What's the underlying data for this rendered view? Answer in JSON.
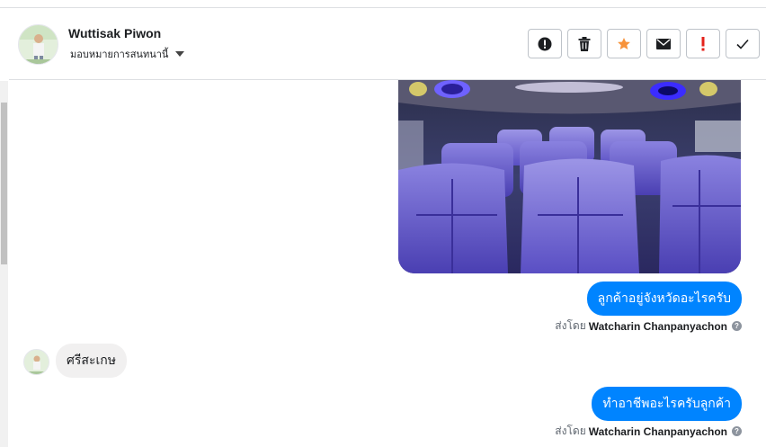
{
  "header": {
    "contact_name": "Wuttisak Piwon",
    "assign_label": "มอบหมายการสนทนานี้"
  },
  "actions": [
    {
      "name": "mark-spam-button",
      "icon": "exclamation-circle-icon"
    },
    {
      "name": "delete-button",
      "icon": "trash-icon"
    },
    {
      "name": "star-button",
      "icon": "star-icon",
      "color": "#f7923a"
    },
    {
      "name": "mark-unread-button",
      "icon": "envelope-icon"
    },
    {
      "name": "follow-up-button",
      "icon": "exclamation-mark-icon",
      "color": "#e4221b"
    },
    {
      "name": "mark-done-button",
      "icon": "checkmark-icon"
    }
  ],
  "messages": [
    {
      "direction": "out",
      "type": "image",
      "subject": "van interior with purple seats"
    },
    {
      "direction": "out",
      "type": "text",
      "text": "ลูกค้าอยู่จังหวัดอะไรครับ",
      "sent_by_prefix": "ส่งโดย",
      "sent_by_name": "Watcharin Chanpanyachon"
    },
    {
      "direction": "in",
      "type": "text",
      "text": "ศรีสะเกษ"
    },
    {
      "direction": "out",
      "type": "text",
      "text": "ทำอาชีพอะไรครับลูกค้า",
      "sent_by_prefix": "ส่งโดย",
      "sent_by_name": "Watcharin Chanpanyachon"
    }
  ],
  "colors": {
    "bubble_out": "#0084ff",
    "bubble_in": "#f1f0f0",
    "divider": "#dddfe2"
  }
}
